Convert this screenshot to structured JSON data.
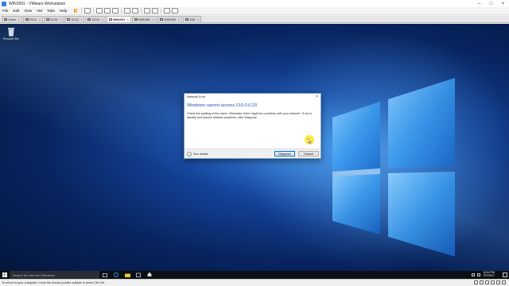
{
  "window": {
    "title": "WIN1091 - VMware Workstation"
  },
  "menu": {
    "items": [
      "File",
      "Edit",
      "View",
      "VM",
      "Tabs",
      "Help"
    ]
  },
  "tabs": [
    {
      "label": "Home",
      "active": false
    },
    {
      "label": "DC21",
      "active": false
    },
    {
      "label": "DC22",
      "active": false
    },
    {
      "label": "DC23",
      "active": false
    },
    {
      "label": "DC24",
      "active": false
    },
    {
      "label": "WIN1091",
      "active": true
    },
    {
      "label": "WIN1092",
      "active": false
    },
    {
      "label": "WIN1093",
      "active": false
    },
    {
      "label": "ASA",
      "active": false
    }
  ],
  "desktop": {
    "recycle_bin_label": "Recycle Bin"
  },
  "dialog": {
    "title": "Network Error",
    "heading": "Windows cannot access \\\\10.0.0.23",
    "body": "Check the spelling of the name. Otherwise, there might be a problem with your network. To try to identify and resolve network problems, click Diagnose.",
    "see_details": "See details",
    "diagnose_label": "Diagnose",
    "cancel_label": "Cancel"
  },
  "taskbar": {
    "search_placeholder": "Search the web and Windows",
    "time": "10:04 PM",
    "date": "7/27/2017"
  },
  "statusbar": {
    "text": "To return to your computer, move the mouse pointer outside or press Ctrl+Alt."
  },
  "colors": {
    "accent": "#0078d7",
    "dialog_heading": "#1e4fa8",
    "pause_icon": "#e8a21a",
    "cursor_highlight": "#ffe100"
  }
}
